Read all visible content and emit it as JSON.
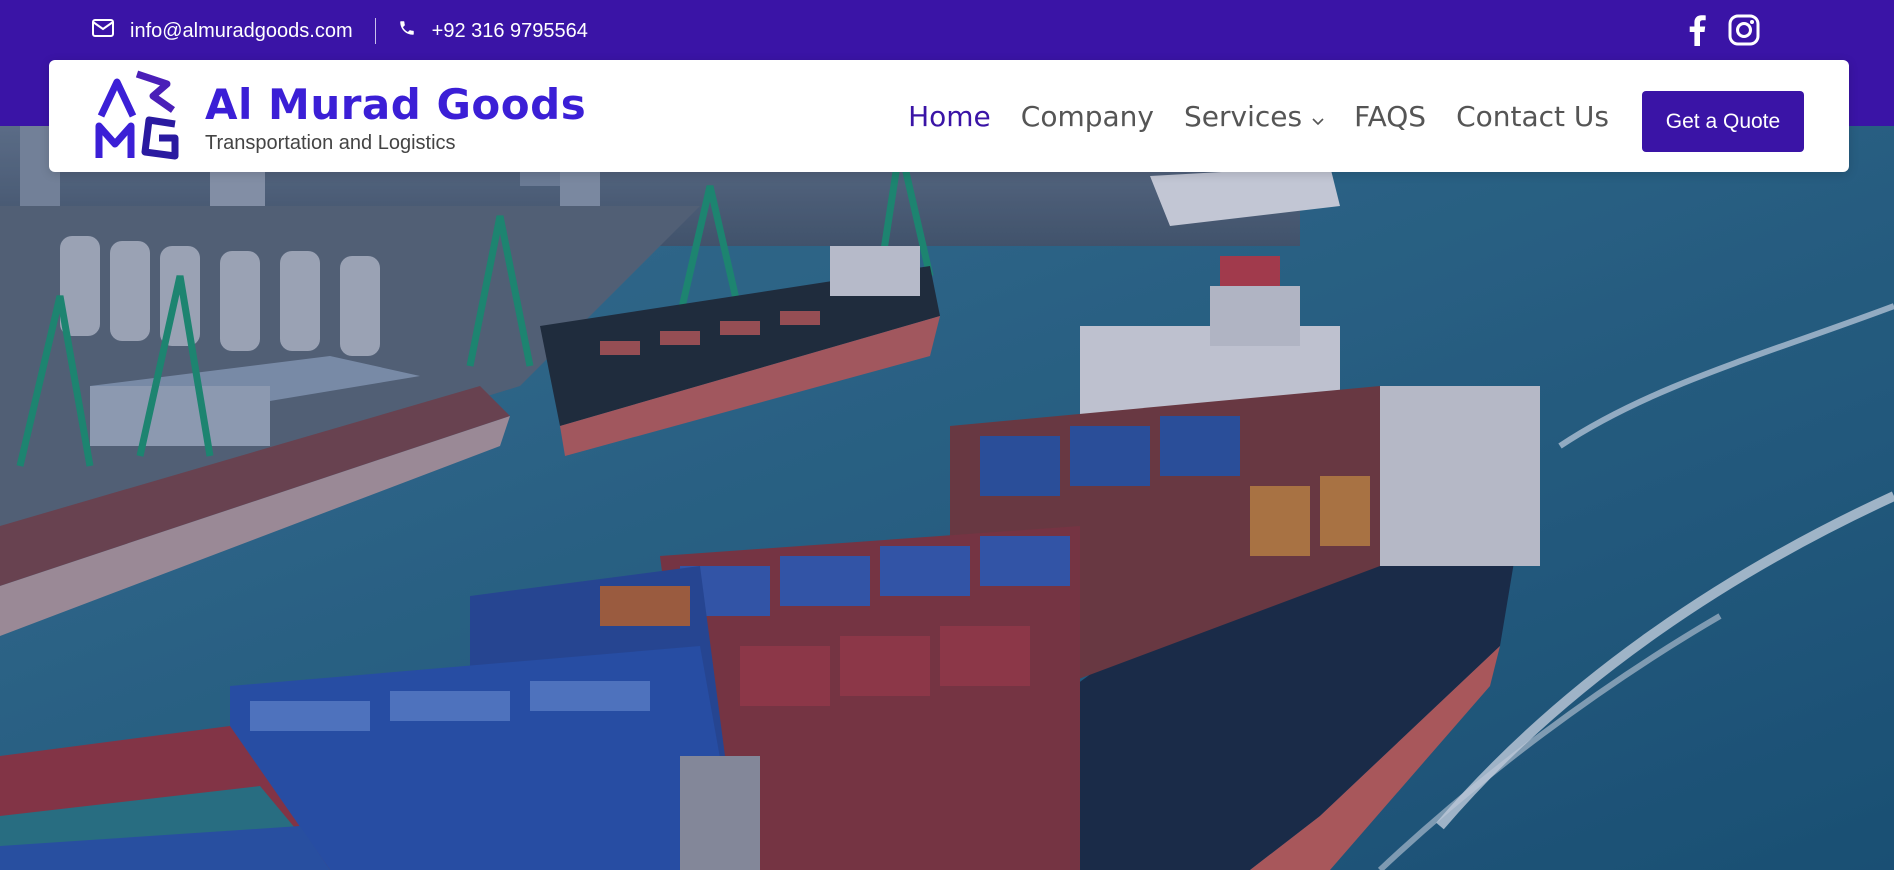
{
  "topbar": {
    "email": "info@almuradgoods.com",
    "phone": "+92 316 9795564",
    "icons": {
      "email": "envelope-icon",
      "phone": "phone-icon",
      "facebook": "facebook-icon",
      "instagram": "instagram-icon"
    }
  },
  "brand": {
    "name": "Al Murad Goods",
    "tagline": "Transportation and Logistics",
    "logo_icon": "amg-logo-cube-icon"
  },
  "nav": {
    "items": [
      {
        "label": "Home",
        "active": true
      },
      {
        "label": "Company"
      },
      {
        "label": "Services",
        "has_dropdown": true
      },
      {
        "label": "FAQS"
      },
      {
        "label": "Contact Us"
      }
    ],
    "cta": "Get a Quote"
  },
  "colors": {
    "primary": "#3a14a6",
    "brand_text": "#3b1fd6",
    "nav_text": "#555555"
  },
  "hero": {
    "image": "aerial-container-ship-at-port"
  }
}
